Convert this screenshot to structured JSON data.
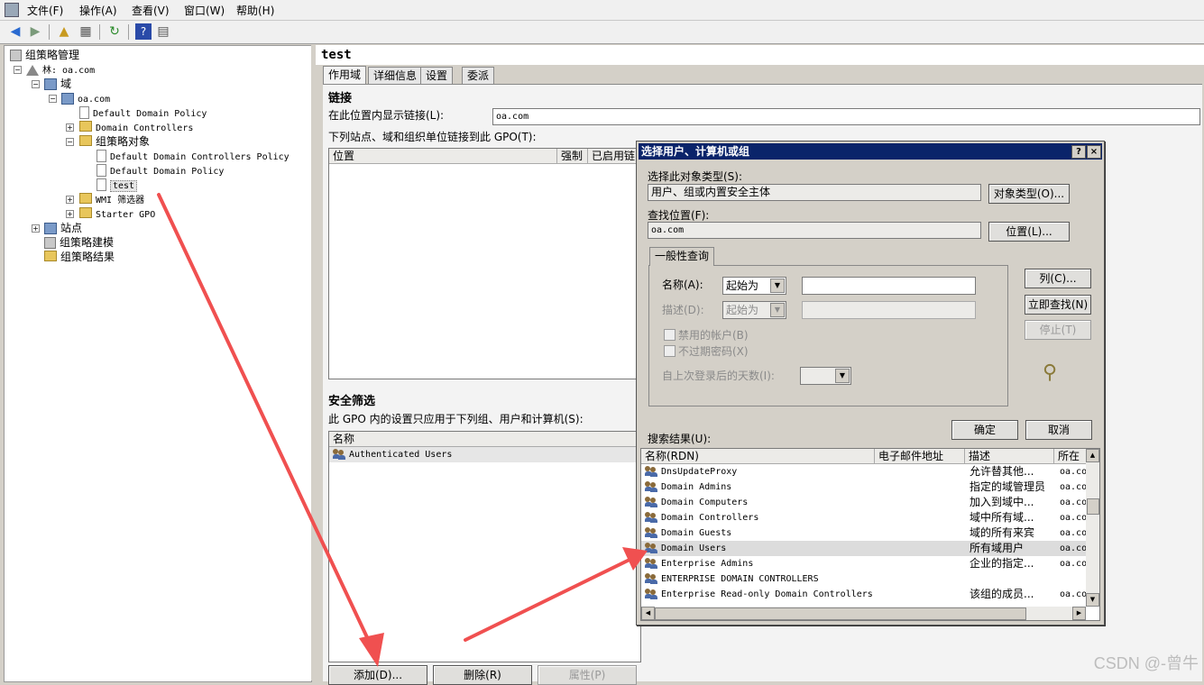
{
  "menubar": {
    "items": [
      "文件(F)",
      "操作(A)",
      "查看(V)",
      "窗口(W)",
      "帮助(H)"
    ]
  },
  "toolbar": {
    "buttons": [
      "back-arrow-icon",
      "forward-arrow-icon",
      "up-folder-icon",
      "show-hide-tree-icon",
      "refresh-icon",
      "help-icon",
      "console-icon"
    ]
  },
  "tree": {
    "root": "组策略管理",
    "forest": "林: oa.com",
    "domains": "域",
    "domain": "oa.com",
    "default_domain_policy": "Default Domain Policy",
    "domain_controllers": "Domain Controllers",
    "gpo_objects": "组策略对象",
    "gpo_ddcp": "Default Domain Controllers Policy",
    "gpo_ddp": "Default Domain Policy",
    "gpo_test": "test",
    "wmi": "WMI 筛选器",
    "starter": "Starter GPO",
    "sites": "站点",
    "modeling": "组策略建模",
    "results": "组策略结果"
  },
  "details": {
    "title": "test",
    "tabs": [
      "作用域",
      "详细信息",
      "设置",
      "委派"
    ],
    "links_heading": "链接",
    "show_links_label": "在此位置内显示链接(L):",
    "show_links_value": "oa.com",
    "linked_label": "下列站点、域和组织单位链接到此 GPO(T):",
    "link_columns": [
      "位置",
      "强制",
      "已启用链"
    ],
    "security_heading": "安全筛选",
    "security_desc": "此 GPO 内的设置只应用于下列组、用户和计算机(S):",
    "security_column": "名称",
    "security_items": [
      "Authenticated Users"
    ],
    "btn_add": "添加(D)...",
    "btn_remove": "删除(R)",
    "btn_props": "属性(P)"
  },
  "dialog": {
    "title": "选择用户、计算机或组",
    "help_btn": "?",
    "close_btn": "×",
    "obj_type_label": "选择此对象类型(S):",
    "obj_type_value": "用户、组或内置安全主体",
    "obj_type_btn": "对象类型(O)...",
    "location_label": "查找位置(F):",
    "location_value": "oa.com",
    "location_btn": "位置(L)...",
    "tab_general": "一般性查询",
    "name_label": "名称(A):",
    "name_mode": "起始为",
    "desc_label": "描述(D):",
    "desc_mode": "起始为",
    "disabled_accounts": "禁用的帐户(B)",
    "non_expiring": "不过期密码(X)",
    "days_label": "自上次登录后的天数(I):",
    "btn_columns": "列(C)...",
    "btn_find_now": "立即查找(N)",
    "btn_stop": "停止(T)",
    "btn_ok": "确定",
    "btn_cancel": "取消",
    "results_label": "搜索结果(U):",
    "result_columns": [
      "名称(RDN)",
      "电子邮件地址",
      "描述",
      "所在文"
    ],
    "results": [
      {
        "name": "DnsUpdateProxy",
        "desc": "允许替其他...",
        "loc": "oa.co"
      },
      {
        "name": "Domain Admins",
        "desc": "指定的域管理员",
        "loc": "oa.co"
      },
      {
        "name": "Domain Computers",
        "desc": "加入到域中...",
        "loc": "oa.co"
      },
      {
        "name": "Domain Controllers",
        "desc": "域中所有域...",
        "loc": "oa.co"
      },
      {
        "name": "Domain Guests",
        "desc": "域的所有来宾",
        "loc": "oa.co"
      },
      {
        "name": "Domain Users",
        "desc": "所有域用户",
        "loc": "oa.co"
      },
      {
        "name": "Enterprise Admins",
        "desc": "企业的指定...",
        "loc": "oa.co"
      },
      {
        "name": "ENTERPRISE DOMAIN CONTROLLERS",
        "desc": "",
        "loc": ""
      },
      {
        "name": "Enterprise Read-only Domain Controllers",
        "desc": "该组的成员...",
        "loc": "oa.co"
      }
    ],
    "selected_index": 5
  },
  "watermark": "CSDN @-曾牛",
  "colors": {
    "title_bar": "#0a246a",
    "annotation_arrow": "#f05050",
    "selection": "#dcdcdc"
  }
}
